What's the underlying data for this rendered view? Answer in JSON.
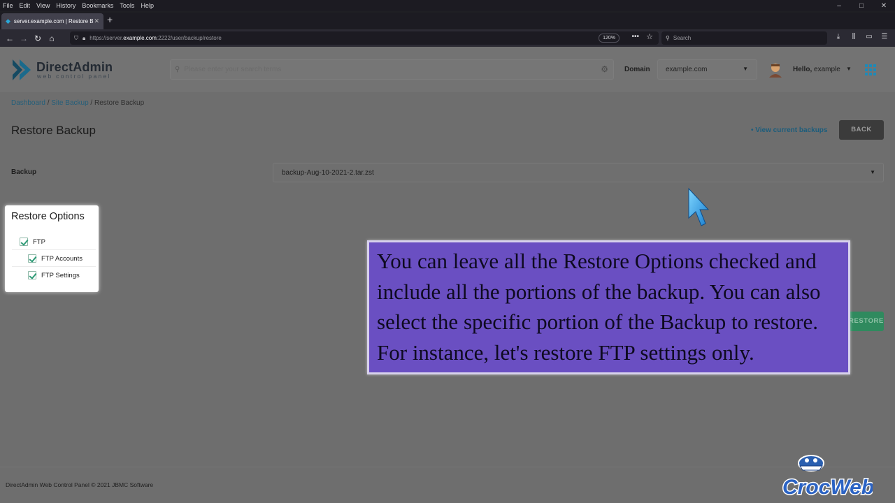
{
  "browser": {
    "menu": [
      "File",
      "Edit",
      "View",
      "History",
      "Bookmarks",
      "Tools",
      "Help"
    ],
    "window_controls": [
      "–",
      "□",
      "✕"
    ],
    "tab_title": "server.example.com | Restore B",
    "url_prefix": "https://server.",
    "url_host": "example.com",
    "url_rest": ":2222/user/backup/restore",
    "zoom": "120%",
    "search_placeholder": "Search",
    "icons": [
      "back-icon",
      "forward-icon",
      "reload-icon",
      "home-icon",
      "shield-icon",
      "lock-icon",
      "more-icon",
      "bookmark-star-icon",
      "download-icon",
      "library-icon",
      "sidebar-icon",
      "menu-icon"
    ]
  },
  "header": {
    "brand_name": "DirectAdmin",
    "brand_sub": "web control panel",
    "search_placeholder": "Please enter your search terms",
    "domain_label": "Domain",
    "domain_value": "example.com",
    "hello_prefix": "Hello,",
    "hello_user": "example"
  },
  "breadcrumb": {
    "items": [
      "Dashboard",
      "Site Backup",
      "Restore Backup"
    ],
    "separator": " / "
  },
  "main": {
    "title": "Restore Backup",
    "view_link": "• View current backups",
    "back_button": "BACK",
    "backup_label": "Backup",
    "backup_value": "backup-Aug-10-2021-2.tar.zst",
    "restore_button": "RESTORE"
  },
  "restore_options": {
    "title": "Restore Options",
    "options": [
      {
        "label": "FTP",
        "checked": true,
        "level": 0
      },
      {
        "label": "FTP Accounts",
        "checked": true,
        "level": 1
      },
      {
        "label": "FTP Settings",
        "checked": true,
        "level": 1
      }
    ]
  },
  "callout": {
    "text": "You can leave all the Restore Options checked and include all the portions of the backup. You can also select the specific portion of the Backup to restore. For instance, let's restore FTP settings only."
  },
  "footer": {
    "text": "DirectAdmin Web Control Panel © 2021 JBMC Software"
  },
  "watermark": {
    "text": "CrocWeb"
  },
  "colors": {
    "callout_bg": "#6a4fc2",
    "accent_blue": "#1e8ab8",
    "check_green": "#2e9b76",
    "overlay_gray": "#6e6e6e"
  }
}
